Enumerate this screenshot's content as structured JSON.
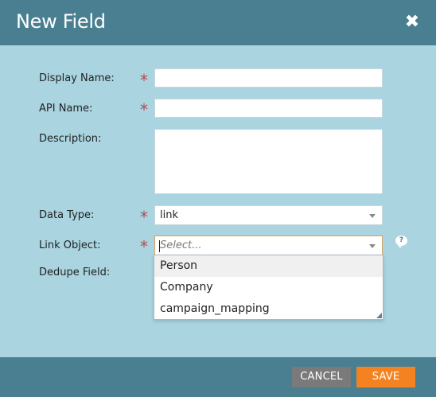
{
  "dialog": {
    "title": "New Field",
    "close_icon": "close-icon"
  },
  "form": {
    "display_name": {
      "label": "Display Name:",
      "value": "",
      "required_mark": "*"
    },
    "api_name": {
      "label": "API Name:",
      "value": "",
      "required_mark": "*"
    },
    "description": {
      "label": "Description:",
      "value": ""
    },
    "data_type": {
      "label": "Data Type:",
      "value": "link",
      "required_mark": "*"
    },
    "link_object": {
      "label": "Link Object:",
      "placeholder": "Select...",
      "required_mark": "*",
      "options": [
        "Person",
        "Company",
        "campaign_mapping"
      ]
    },
    "dedupe_field": {
      "label": "Dedupe Field:"
    },
    "help_icon": "help-bubble-icon"
  },
  "footer": {
    "cancel_label": "CANCEL",
    "save_label": "SAVE"
  },
  "colors": {
    "header": "#4a7f92",
    "body": "#a9d4e0",
    "required": "#b34d4d",
    "save": "#f58220",
    "cancel": "#7a7a7a"
  }
}
